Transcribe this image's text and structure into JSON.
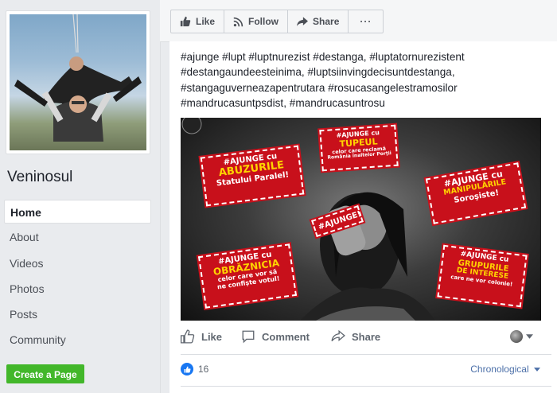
{
  "sidebar": {
    "page_name": "Veninosul",
    "nav": [
      {
        "label": "Home",
        "active": true
      },
      {
        "label": "About"
      },
      {
        "label": "Videos"
      },
      {
        "label": "Photos"
      },
      {
        "label": "Posts"
      },
      {
        "label": "Community"
      }
    ],
    "create_page_label": "Create a Page"
  },
  "topbar": {
    "like_label": "Like",
    "follow_label": "Follow",
    "share_label": "Share",
    "more_label": "···"
  },
  "post": {
    "text": "#ajunge #lupt #luptnurezist #destanga, #luptatornurezistent #destangaundeesteinima, #luptsiinvingdecisuntdestanga, #stangaguverneazapentrutara #rosucasangelestramosilor #mandrucasuntpsdist, #mandrucasuntrosu",
    "image": {
      "stickers": [
        {
          "line1": "#AJUNGE cu",
          "line2": "TUPEUL",
          "line3": "celor care reclamă",
          "line4": "România înaltelor Porţii"
        },
        {
          "line1": "#AJUNGE cu",
          "line2": "ABUZURILE",
          "line3": "Statului Paralel!"
        },
        {
          "line1": "#AJUNGE cu",
          "line2": "MANIPULĂRILE",
          "line3": "Soroşiste!"
        },
        {
          "line1": "#AJUNGE!"
        },
        {
          "line1": "#AJUNGE cu",
          "line2": "OBRĂZNICIA",
          "line3": "celor care vor să",
          "line4": "ne confişte votul!"
        },
        {
          "line1": "#AJUNGE cu",
          "line2": "GRUPURILE",
          "line3": "DE INTERESE",
          "line4": "care ne vor colonie!"
        }
      ]
    },
    "actions": {
      "like": "Like",
      "comment": "Comment",
      "share": "Share"
    },
    "reactions_count": "16",
    "sort_label": "Chronological"
  },
  "colors": {
    "facebook_blue": "#1877f2",
    "green": "#42b72a",
    "sticker_red": "#c8101b"
  },
  "icons": [
    "thumbs-up-icon",
    "rss-icon",
    "share-arrow-icon",
    "more-icon",
    "comment-icon",
    "chevron-down-icon"
  ]
}
